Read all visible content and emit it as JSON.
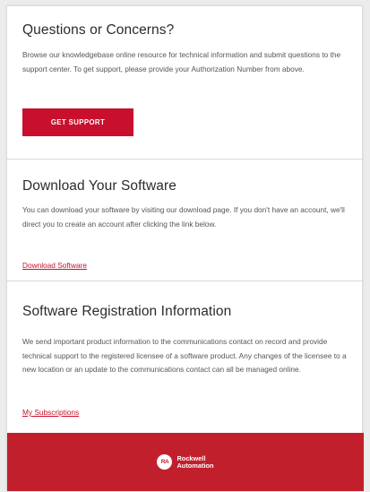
{
  "questions": {
    "title": "Questions or Concerns?",
    "body": "Browse our knowledgebase online resource for technical information and submit questions to the support center. To get support, please provide your Authorization Number from above.",
    "button_label": "GET SUPPORT"
  },
  "download": {
    "title": "Download Your Software",
    "body": "You can download your software by visiting our download page. If you don't have an account, we'll direct you to create an account after clicking the link below.",
    "link_label": "Download Software"
  },
  "registration": {
    "title": "Software Registration Information",
    "body": "We send important product information to the communications contact on record and provide technical support to the registered licensee of a software product. Any changes of the licensee to a new location or an update to the communications contact can all be managed online.",
    "link_label": "My Subscriptions"
  },
  "footer": {
    "logo_mark": "RA",
    "logo_line1": "Rockwell",
    "logo_line2": "Automation"
  },
  "colors": {
    "accent": "#c8102e",
    "footer_bg": "#c21f2c"
  }
}
